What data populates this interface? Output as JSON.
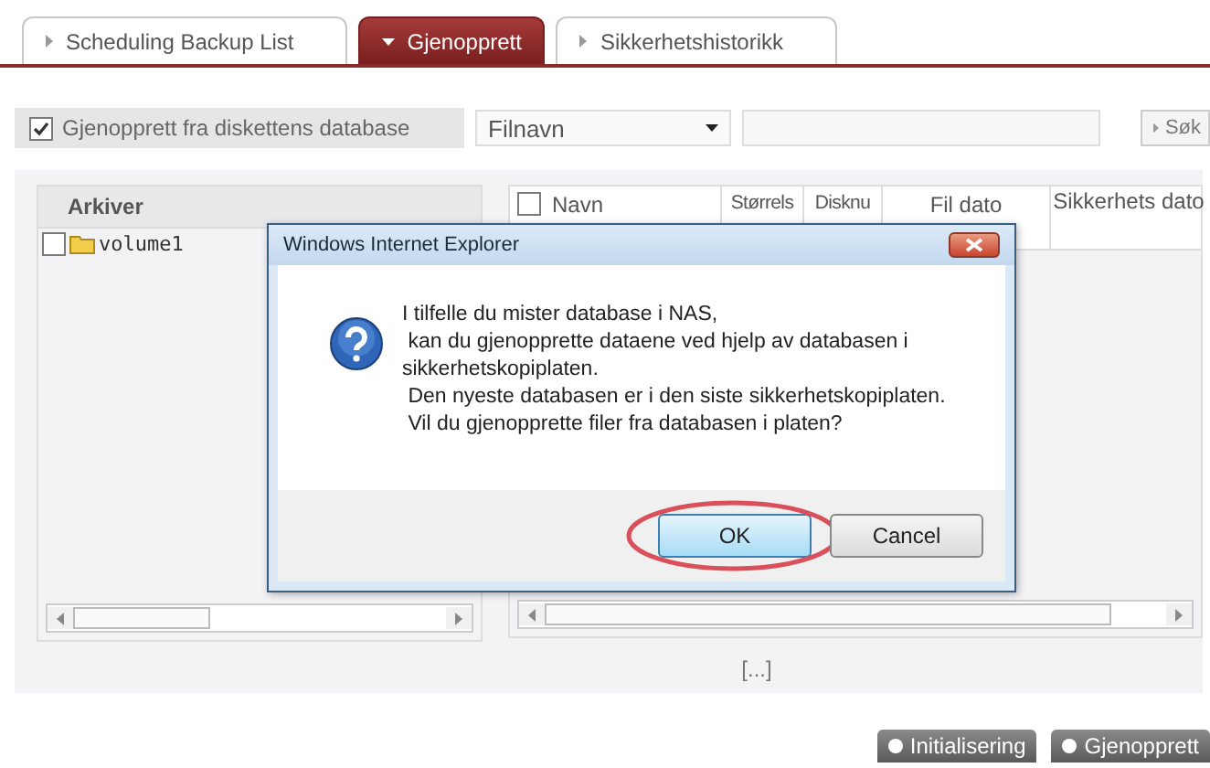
{
  "tabs": [
    {
      "label": "Scheduling Backup List",
      "selected": false
    },
    {
      "label": "Gjenopprett",
      "selected": true
    },
    {
      "label": "Sikkerhetshistorikk",
      "selected": false
    }
  ],
  "filter": {
    "checkbox": {
      "label": "Gjenopprett fra diskettens database",
      "checked": true
    },
    "dropdown": {
      "value": "Filnavn"
    },
    "search_button": "Søk"
  },
  "tree": {
    "header": "Arkiver",
    "items": [
      {
        "label": "volume1",
        "checked": false
      }
    ]
  },
  "table": {
    "header_checkbox": {
      "checked": false
    },
    "columns": [
      "Navn",
      "Størrels",
      "Disknu",
      "Fil dato",
      "Sikkerhets dato"
    ]
  },
  "pagination": "[...]",
  "buttons": [
    {
      "label": "Initialisering"
    },
    {
      "label": "Gjenopprett"
    }
  ],
  "dialog": {
    "title": "Windows Internet Explorer",
    "message_lines": [
      "I tilfelle du mister database i NAS,",
      " kan du gjenopprette dataene ved hjelp av databasen i",
      "sikkerhetskopiplaten.",
      " Den nyeste databasen er i den siste sikkerhetskopiplaten.",
      " Vil du gjenopprette filer fra databasen i platen?"
    ],
    "buttons": [
      {
        "label": "OK",
        "focused": true,
        "circled": true
      },
      {
        "label": "Cancel",
        "focused": false,
        "circled": false
      }
    ]
  }
}
